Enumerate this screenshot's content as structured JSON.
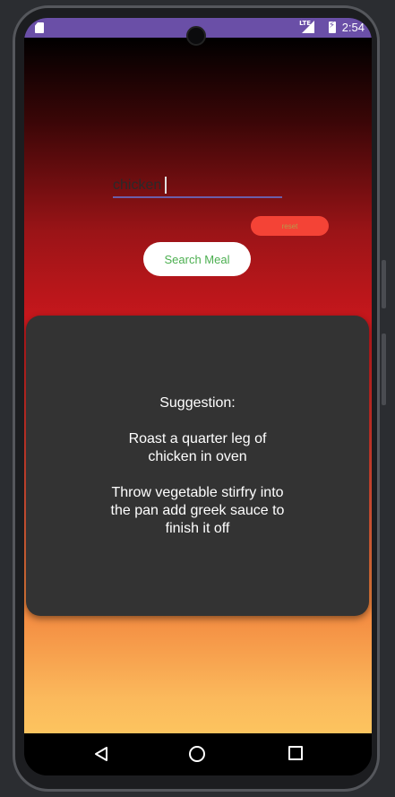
{
  "status_bar": {
    "time": "2:54",
    "network": "LTE",
    "icons": [
      "sd-card-icon",
      "lte-signal-icon",
      "battery-icon"
    ]
  },
  "search": {
    "value": "chicken",
    "placeholder": ""
  },
  "buttons": {
    "reset_label": "reset",
    "search_label": "Search Meal"
  },
  "suggestion": {
    "text": "Suggestion:\n\nRoast a quarter leg of chicken in oven\n\nThrow vegetable stirfry into the pan add greek sauce to finish it off"
  },
  "nav": {
    "icons": [
      "back-icon",
      "home-icon",
      "recents-icon"
    ]
  },
  "colors": {
    "status_bar": "#6a4fa7",
    "reset_button": "#f44336",
    "search_button_text": "#4caf50",
    "card_background": "#333333"
  }
}
